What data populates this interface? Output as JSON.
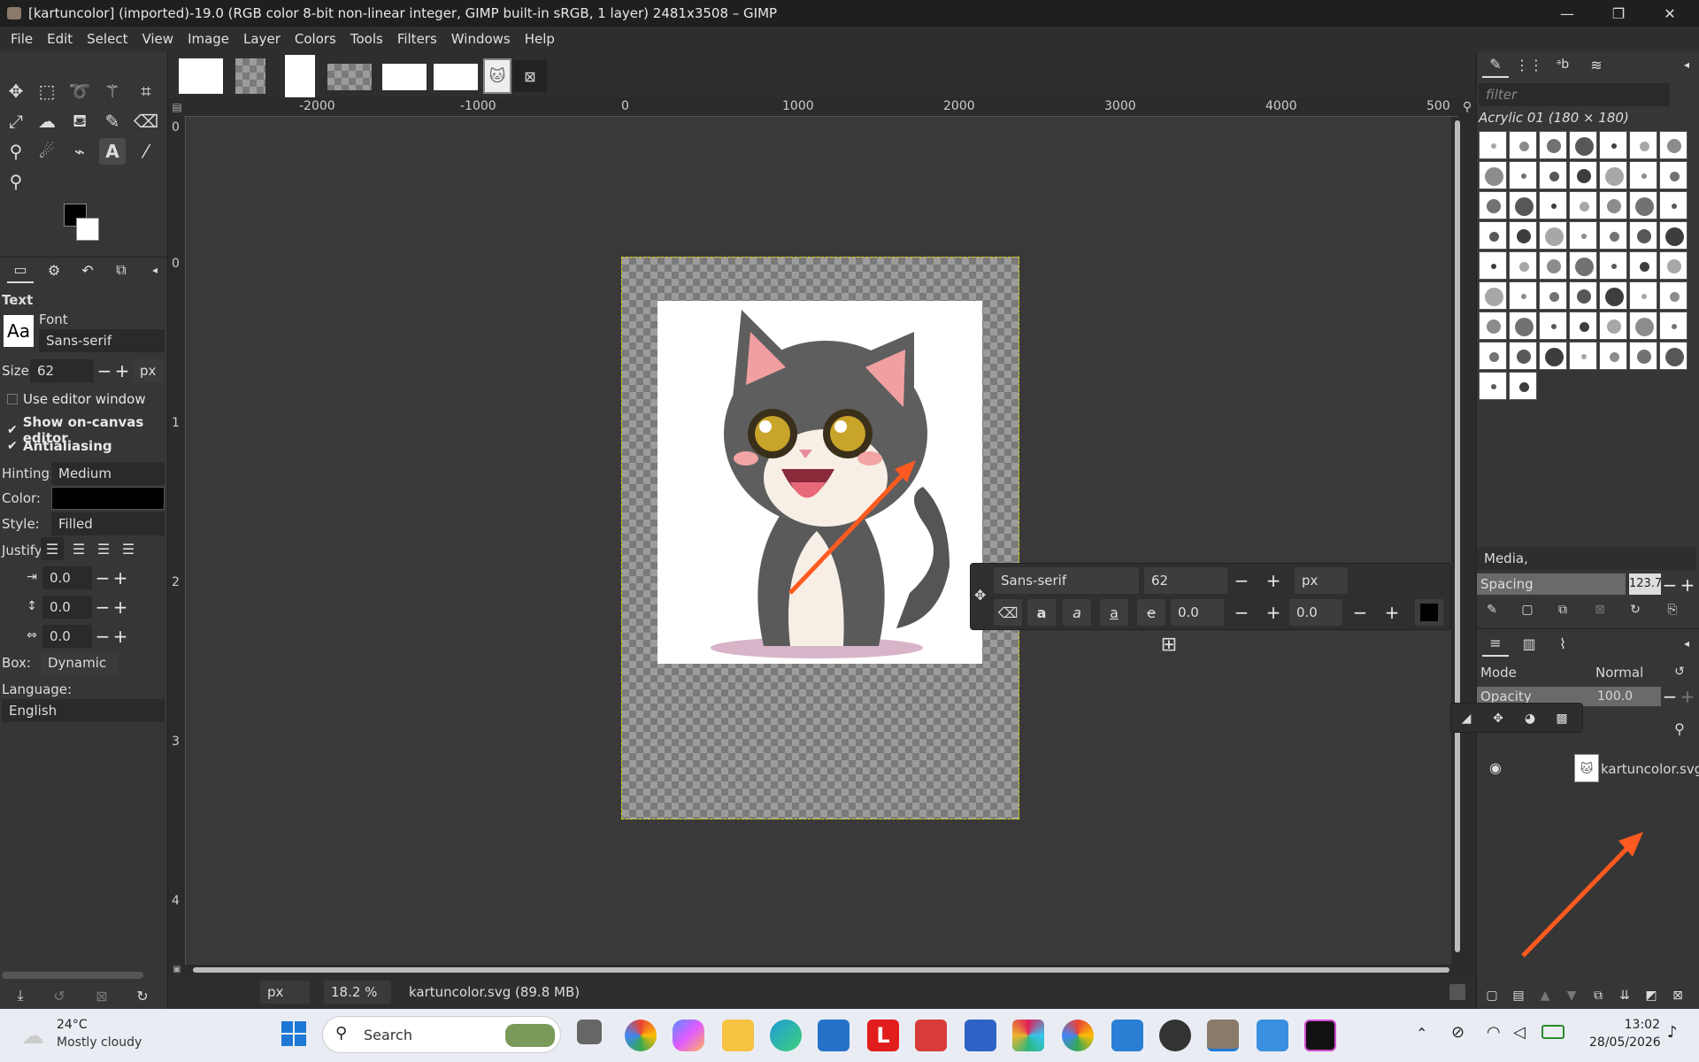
{
  "window": {
    "title": "[kartuncolor] (imported)-19.0 (RGB color 8-bit non-linear integer, GIMP built-in sRGB, 1 layer) 2481x3508 – GIMP",
    "minimize": "—",
    "maximize": "❐",
    "close": "✕"
  },
  "menu": [
    "File",
    "Edit",
    "Select",
    "View",
    "Image",
    "Layer",
    "Colors",
    "Tools",
    "Filters",
    "Windows",
    "Help"
  ],
  "tool_options": {
    "section_title": "Text",
    "font_label": "Font",
    "font_preview": "Aa",
    "font_value": "Sans-serif",
    "size_label": "Size:",
    "size_value": "62",
    "size_unit": "px",
    "use_editor_window": "Use editor window",
    "show_on_canvas_editor": "Show on-canvas editor",
    "antialiasing": "Antialiasing",
    "hinting_label": "Hinting:",
    "hinting_value": "Medium",
    "color_label": "Color:",
    "color_value": "#000000",
    "style_label": "Style:",
    "style_value": "Filled",
    "justify_label": "Justify:",
    "indent_value": "0.0",
    "line_spacing_value": "0.0",
    "letter_spacing_value": "0.0",
    "box_label": "Box:",
    "box_value": "Dynamic",
    "language_label": "Language:",
    "language_value": "English"
  },
  "ruler": {
    "h_ticks": [
      "-2000",
      "-1000",
      "0",
      "1000",
      "2000",
      "3000",
      "4000",
      "500"
    ],
    "v_ticks": [
      "0",
      "0",
      "1",
      "2",
      "3",
      "4"
    ]
  },
  "text_overlay": {
    "font": "Sans-serif",
    "size": "62",
    "unit": "px",
    "baseline": "0.0",
    "kerning": "0.0"
  },
  "status": {
    "unit": "px",
    "zoom": "18.2 %",
    "file_info": "kartuncolor.svg (89.8 MB)"
  },
  "brushes": {
    "filter_placeholder": "filter",
    "brush_name": "Acrylic 01 (180 × 180)",
    "category": "Media,",
    "spacing_label": "Spacing",
    "spacing_value": "123.7"
  },
  "layers": {
    "mode_label": "Mode",
    "mode_value": "Normal",
    "opacity_label": "Opacity",
    "opacity_value": "100.0",
    "items": [
      {
        "name": "kartuncolor.svg"
      }
    ]
  },
  "taskbar": {
    "temperature": "24°C",
    "weather": "Mostly cloudy",
    "search_label": "Search",
    "time": "13:02",
    "date": "28/05/2026"
  },
  "colors": {
    "accent_arrow": "#ff5a1f",
    "selection_dash": "#d8d800"
  }
}
